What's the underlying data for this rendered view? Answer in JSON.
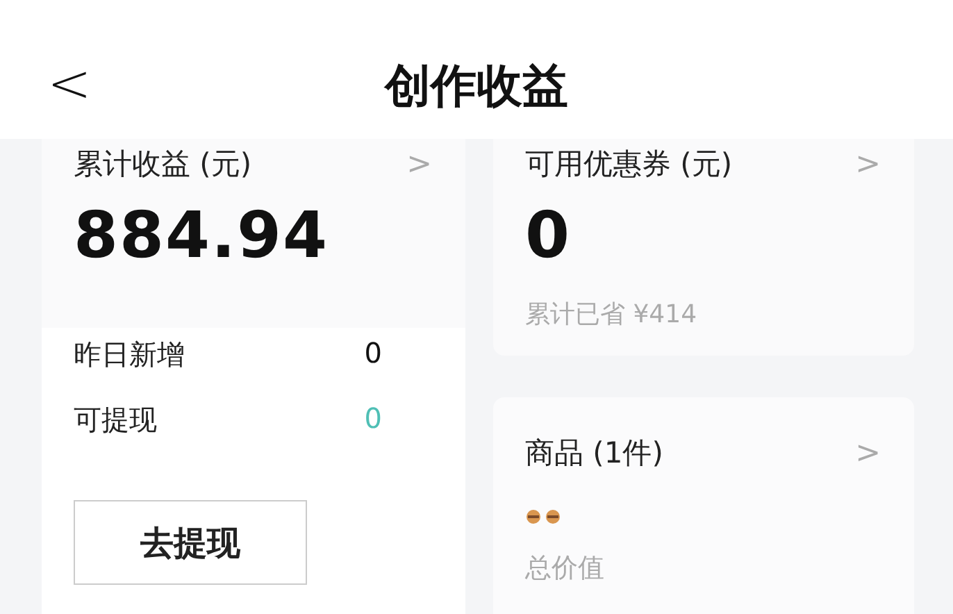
{
  "header": {
    "back": "<",
    "title": "创作收益"
  },
  "earnings": {
    "label": "累计收益 (元)",
    "arrow": ">",
    "amount": "884.94",
    "rows": [
      {
        "label": "昨日新增",
        "value": "0",
        "accent": false
      },
      {
        "label": "可提现",
        "value": "0",
        "accent": true
      }
    ],
    "button": "去提现"
  },
  "coupons": {
    "label": "可用优惠券 (元)",
    "arrow": ">",
    "amount": "0",
    "note": "累计已省 ¥414"
  },
  "goods": {
    "label": "商品 (1件)",
    "arrow": ">",
    "total_label": "总价值"
  }
}
